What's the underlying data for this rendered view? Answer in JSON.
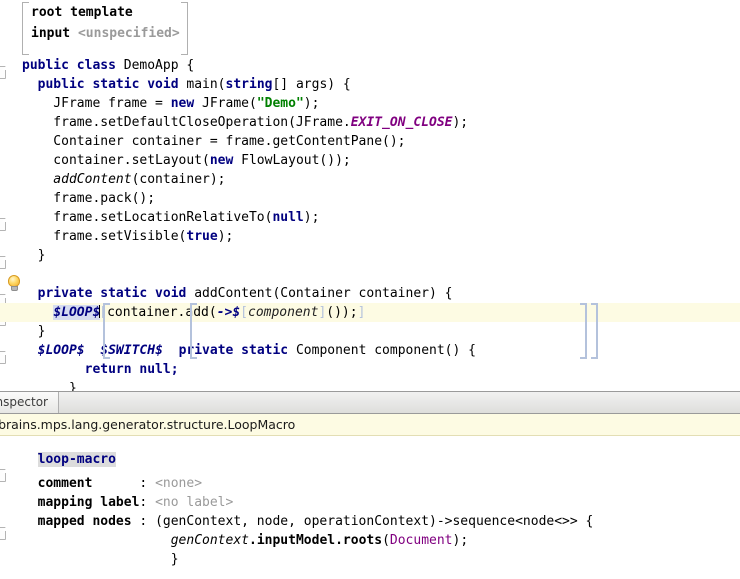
{
  "editor": {
    "header_block": {
      "line1": "root template",
      "line2_label": "input ",
      "line2_value": "<unspecified>"
    },
    "gutter": {
      "bulb_icon": "lightbulb-icon",
      "fold_icon": "fold-marker-icon"
    },
    "lines": {
      "l1_a": "public class ",
      "l1_b": "DemoApp {",
      "l2_a": "  public static void ",
      "l2_b": "main(",
      "l2_c": "string",
      "l2_d": "[] args) {",
      "l3_a": "    JFrame frame = ",
      "l3_b": "new ",
      "l3_c": "JFrame(",
      "l3_d": "\"Demo\"",
      "l3_e": ");",
      "l4_a": "    frame.setDefaultCloseOperation(JFrame.",
      "l4_b": "EXIT_ON_CLOSE",
      "l4_c": ");",
      "l5": "    Container container = frame.getContentPane();",
      "l6_a": "    container.setLayout(",
      "l6_b": "new ",
      "l6_c": "FlowLayout());",
      "l7_a": "    addContent",
      "l7_b": "(container);",
      "l8": "    frame.pack();",
      "l9_a": "    frame.setLocationRelativeTo(",
      "l9_b": "null",
      "l9_c": ");",
      "l10_a": "    frame.setVisible(",
      "l10_b": "true",
      "l10_c": ");",
      "l11": "  }",
      "l12_a": "  private static void ",
      "l12_b": "addContent(Container container) {",
      "l13_macro": "$LOOP$",
      "l13_brk1": "[",
      "l13_a": "container.add(",
      "l13_cell": "->$",
      "l13_brk2": "[",
      "l13_ph": "component",
      "l13_brk3": "]",
      "l13_b": "());",
      "l13_brk4": "]",
      "l14": "  }",
      "l15_m1": "$LOOP$",
      "l15_m2": "$SWITCH$",
      "l15_a": "private static ",
      "l15_b": "Component component() {",
      "l16_a": "        return ",
      "l16_b": "null;",
      "l17": "      }",
      "l18": "}"
    }
  },
  "inspector": {
    "tab_label": "Inspector",
    "node_path": "jetbrains.mps.lang.generator.structure.LoopMacro",
    "title": "loop-macro",
    "rows": [
      {
        "label": "comment      ",
        "sep": ": ",
        "value": "<none>",
        "value_style": "gray"
      },
      {
        "label": "mapping label",
        "sep": ": ",
        "value": "<no label>",
        "value_style": "gray"
      },
      {
        "label": "mapped nodes ",
        "sep": ": ",
        "value": "",
        "value_style": "plain"
      }
    ],
    "lambda": {
      "sig": "(genContext, node, operationContext)->sequence<node<>> {",
      "body_a": "genContext",
      "body_b": ".inputModel.",
      "body_c": "roots",
      "body_d": "(",
      "body_e": "Document",
      "body_f": ");",
      "close": "}"
    }
  },
  "colors": {
    "keyword": "#000080",
    "string": "#008000",
    "constant": "#800080",
    "highlight_row": "#fdfbe3",
    "bracket": "#b4c2dc",
    "selection": "#d6dcf0"
  }
}
